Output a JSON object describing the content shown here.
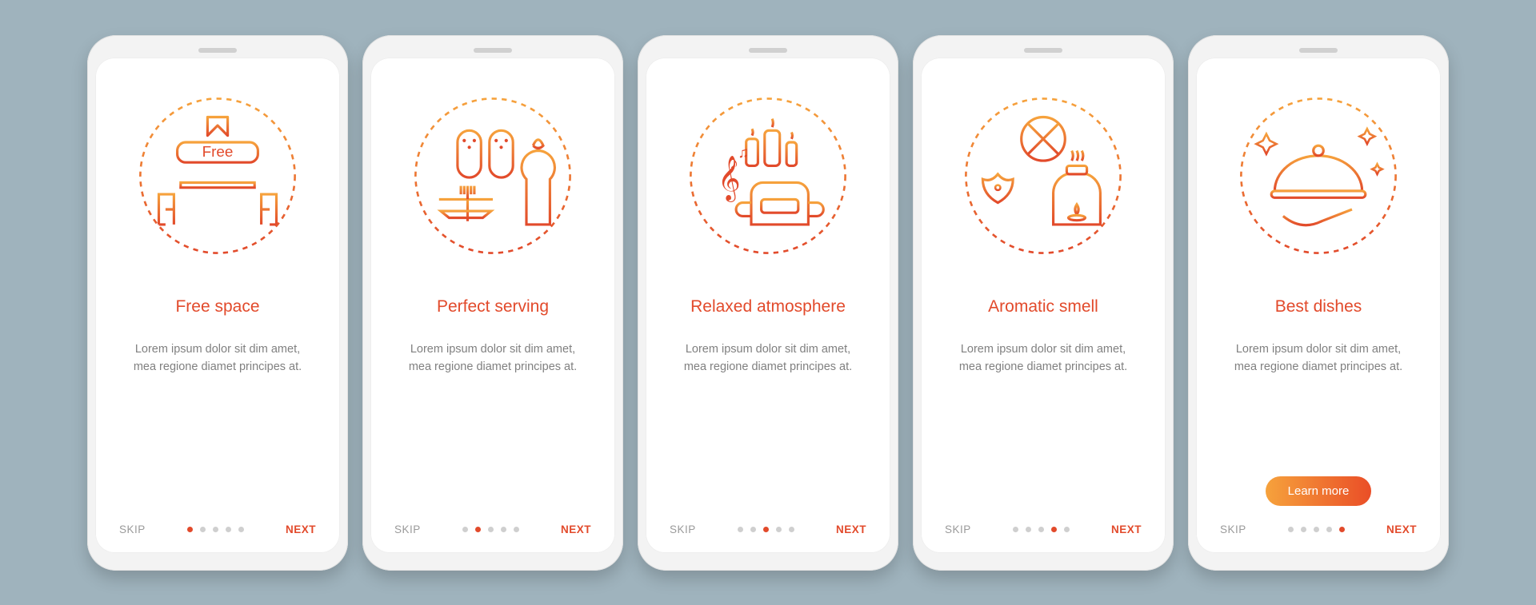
{
  "common": {
    "skip_label": "SKIP",
    "next_label": "NEXT",
    "learn_more_label": "Learn more",
    "body_text": "Lorem ipsum dolor sit dim amet, mea regione diamet principes at.",
    "free_badge": "Free",
    "total_dots": 5
  },
  "screens": [
    {
      "title": "Free space",
      "icon": "free-space-icon",
      "active_dot": 0,
      "cta": false
    },
    {
      "title": "Perfect serving",
      "icon": "perfect-serving-icon",
      "active_dot": 1,
      "cta": false
    },
    {
      "title": "Relaxed atmosphere",
      "icon": "relaxed-icon",
      "active_dot": 2,
      "cta": false
    },
    {
      "title": "Aromatic smell",
      "icon": "aromatic-icon",
      "active_dot": 3,
      "cta": false
    },
    {
      "title": "Best dishes",
      "icon": "best-dishes-icon",
      "active_dot": 4,
      "cta": true
    }
  ]
}
